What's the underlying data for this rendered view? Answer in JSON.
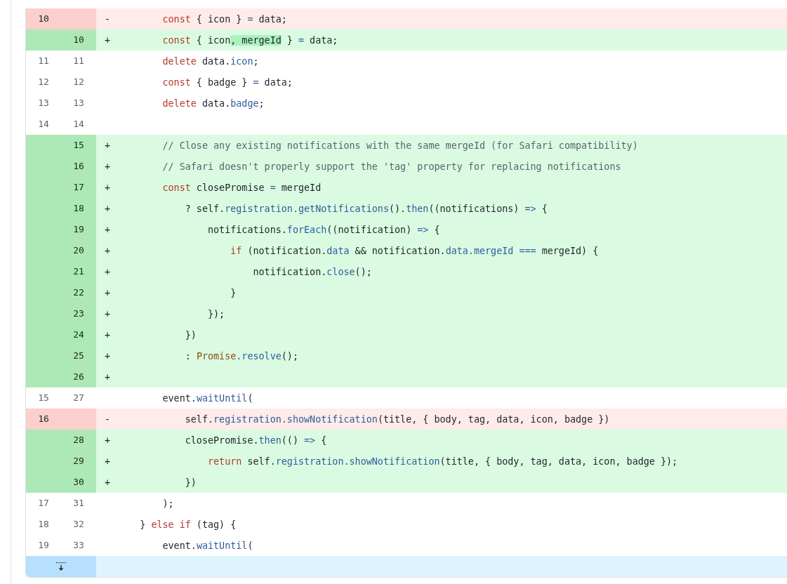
{
  "diff": {
    "rows": [
      {
        "kind": "deletion",
        "old": "10",
        "sign": "-",
        "code": [
          {
            "text": "        const",
            "kind": "keyword"
          },
          {
            "text": " { icon } ",
            "kind": "plain"
          },
          {
            "text": "=",
            "kind": "operator"
          },
          {
            "text": " data;",
            "kind": "plain"
          }
        ]
      },
      {
        "kind": "addition",
        "new": "10",
        "sign": "+",
        "code": [
          {
            "text": "        const",
            "kind": "keyword"
          },
          {
            "text": " { icon",
            "kind": "plain"
          },
          {
            "text": ", mergeId",
            "kind": "changed"
          },
          {
            "text": " } ",
            "kind": "plain"
          },
          {
            "text": "=",
            "kind": "operator"
          },
          {
            "text": " data;",
            "kind": "plain"
          }
        ]
      },
      {
        "kind": "context",
        "old": "11",
        "new": "11",
        "code": [
          {
            "text": "        delete",
            "kind": "keyword"
          },
          {
            "text": " data.",
            "kind": "plain"
          },
          {
            "text": "icon",
            "kind": "member"
          },
          {
            "text": ";",
            "kind": "plain"
          }
        ]
      },
      {
        "kind": "context",
        "old": "12",
        "new": "12",
        "code": [
          {
            "text": "        const",
            "kind": "keyword"
          },
          {
            "text": " { badge } ",
            "kind": "plain"
          },
          {
            "text": "=",
            "kind": "operator"
          },
          {
            "text": " data;",
            "kind": "plain"
          }
        ]
      },
      {
        "kind": "context",
        "old": "13",
        "new": "13",
        "code": [
          {
            "text": "        delete",
            "kind": "keyword"
          },
          {
            "text": " data.",
            "kind": "plain"
          },
          {
            "text": "badge",
            "kind": "member"
          },
          {
            "text": ";",
            "kind": "plain"
          }
        ]
      },
      {
        "kind": "context",
        "old": "14",
        "new": "14"
      },
      {
        "kind": "addition",
        "new": "15",
        "sign": "+",
        "code": [
          {
            "text": "        // Close any existing notifications with the same mergeId (for Safari compatibility)",
            "kind": "comment"
          }
        ]
      },
      {
        "kind": "addition",
        "new": "16",
        "sign": "+",
        "code": [
          {
            "text": "        // Safari doesn't properly support the 'tag' property for replacing notifications",
            "kind": "comment"
          }
        ]
      },
      {
        "kind": "addition",
        "new": "17",
        "sign": "+",
        "code": [
          {
            "text": "        const",
            "kind": "keyword"
          },
          {
            "text": " closePromise ",
            "kind": "plain"
          },
          {
            "text": "=",
            "kind": "operator"
          },
          {
            "text": " mergeId",
            "kind": "plain"
          }
        ]
      },
      {
        "kind": "addition",
        "new": "18",
        "sign": "+",
        "code": [
          {
            "text": "            ? self.",
            "kind": "plain"
          },
          {
            "text": "registration",
            "kind": "member"
          },
          {
            "text": ".getNotifications",
            "kind": "member"
          },
          {
            "text": "().",
            "kind": "plain"
          },
          {
            "text": "then",
            "kind": "member"
          },
          {
            "text": "((notifications) ",
            "kind": "plain"
          },
          {
            "text": "=>",
            "kind": "operator"
          },
          {
            "text": " {",
            "kind": "plain"
          }
        ]
      },
      {
        "kind": "addition",
        "new": "19",
        "sign": "+",
        "code": [
          {
            "text": "                notifications.",
            "kind": "plain"
          },
          {
            "text": "forEach",
            "kind": "member"
          },
          {
            "text": "((notification) ",
            "kind": "plain"
          },
          {
            "text": "=>",
            "kind": "operator"
          },
          {
            "text": " {",
            "kind": "plain"
          }
        ]
      },
      {
        "kind": "addition",
        "new": "20",
        "sign": "+",
        "code": [
          {
            "text": "                    if",
            "kind": "keyword"
          },
          {
            "text": " (notification.",
            "kind": "plain"
          },
          {
            "text": "data",
            "kind": "member"
          },
          {
            "text": " && notification.",
            "kind": "plain"
          },
          {
            "text": "data.mergeId",
            "kind": "member"
          },
          {
            "text": " ===",
            "kind": "operator"
          },
          {
            "text": " mergeId) {",
            "kind": "plain"
          }
        ]
      },
      {
        "kind": "addition",
        "new": "21",
        "sign": "+",
        "code": [
          {
            "text": "                        notification.",
            "kind": "plain"
          },
          {
            "text": "close",
            "kind": "member"
          },
          {
            "text": "();",
            "kind": "plain"
          }
        ]
      },
      {
        "kind": "addition",
        "new": "22",
        "sign": "+",
        "code": [
          {
            "text": "                    }",
            "kind": "plain"
          }
        ]
      },
      {
        "kind": "addition",
        "new": "23",
        "sign": "+",
        "code": [
          {
            "text": "                });",
            "kind": "plain"
          }
        ]
      },
      {
        "kind": "addition",
        "new": "24",
        "sign": "+",
        "code": [
          {
            "text": "            })",
            "kind": "plain"
          }
        ]
      },
      {
        "kind": "addition",
        "new": "25",
        "sign": "+",
        "code": [
          {
            "text": "            : ",
            "kind": "plain"
          },
          {
            "text": "Promise",
            "kind": "class"
          },
          {
            "text": ".resolve",
            "kind": "member"
          },
          {
            "text": "();",
            "kind": "plain"
          }
        ]
      },
      {
        "kind": "addition",
        "new": "26",
        "sign": "+"
      },
      {
        "kind": "context",
        "old": "15",
        "new": "27",
        "code": [
          {
            "text": "        event.",
            "kind": "plain"
          },
          {
            "text": "waitUntil",
            "kind": "member"
          },
          {
            "text": "(",
            "kind": "plain"
          }
        ]
      },
      {
        "kind": "deletion",
        "old": "16",
        "sign": "-",
        "code": [
          {
            "text": "            self.",
            "kind": "plain"
          },
          {
            "text": "registration",
            "kind": "member"
          },
          {
            "text": ".showNotification",
            "kind": "member"
          },
          {
            "text": "(title, { body, tag, data, icon, badge })",
            "kind": "plain"
          }
        ]
      },
      {
        "kind": "addition",
        "new": "28",
        "sign": "+",
        "code": [
          {
            "text": "            closePromise.",
            "kind": "plain"
          },
          {
            "text": "then",
            "kind": "member"
          },
          {
            "text": "(() ",
            "kind": "plain"
          },
          {
            "text": "=>",
            "kind": "operator"
          },
          {
            "text": " {",
            "kind": "plain"
          }
        ]
      },
      {
        "kind": "addition",
        "new": "29",
        "sign": "+",
        "code": [
          {
            "text": "                return",
            "kind": "keyword"
          },
          {
            "text": " self.",
            "kind": "plain"
          },
          {
            "text": "registration",
            "kind": "member"
          },
          {
            "text": ".showNotification",
            "kind": "member"
          },
          {
            "text": "(title, { body, tag, data, icon, badge });",
            "kind": "plain"
          }
        ]
      },
      {
        "kind": "addition",
        "new": "30",
        "sign": "+",
        "code": [
          {
            "text": "            })",
            "kind": "plain"
          }
        ]
      },
      {
        "kind": "context",
        "old": "17",
        "new": "31",
        "code": [
          {
            "text": "        );",
            "kind": "plain"
          }
        ]
      },
      {
        "kind": "context",
        "old": "18",
        "new": "32",
        "code": [
          {
            "text": "    } ",
            "kind": "plain"
          },
          {
            "text": "else if",
            "kind": "keyword"
          },
          {
            "text": " (tag) {",
            "kind": "plain"
          }
        ]
      },
      {
        "kind": "context",
        "old": "19",
        "new": "33",
        "code": [
          {
            "text": "        event.",
            "kind": "plain"
          },
          {
            "text": "waitUntil",
            "kind": "member"
          },
          {
            "text": "(",
            "kind": "plain"
          }
        ]
      },
      {
        "kind": "expand"
      }
    ]
  }
}
